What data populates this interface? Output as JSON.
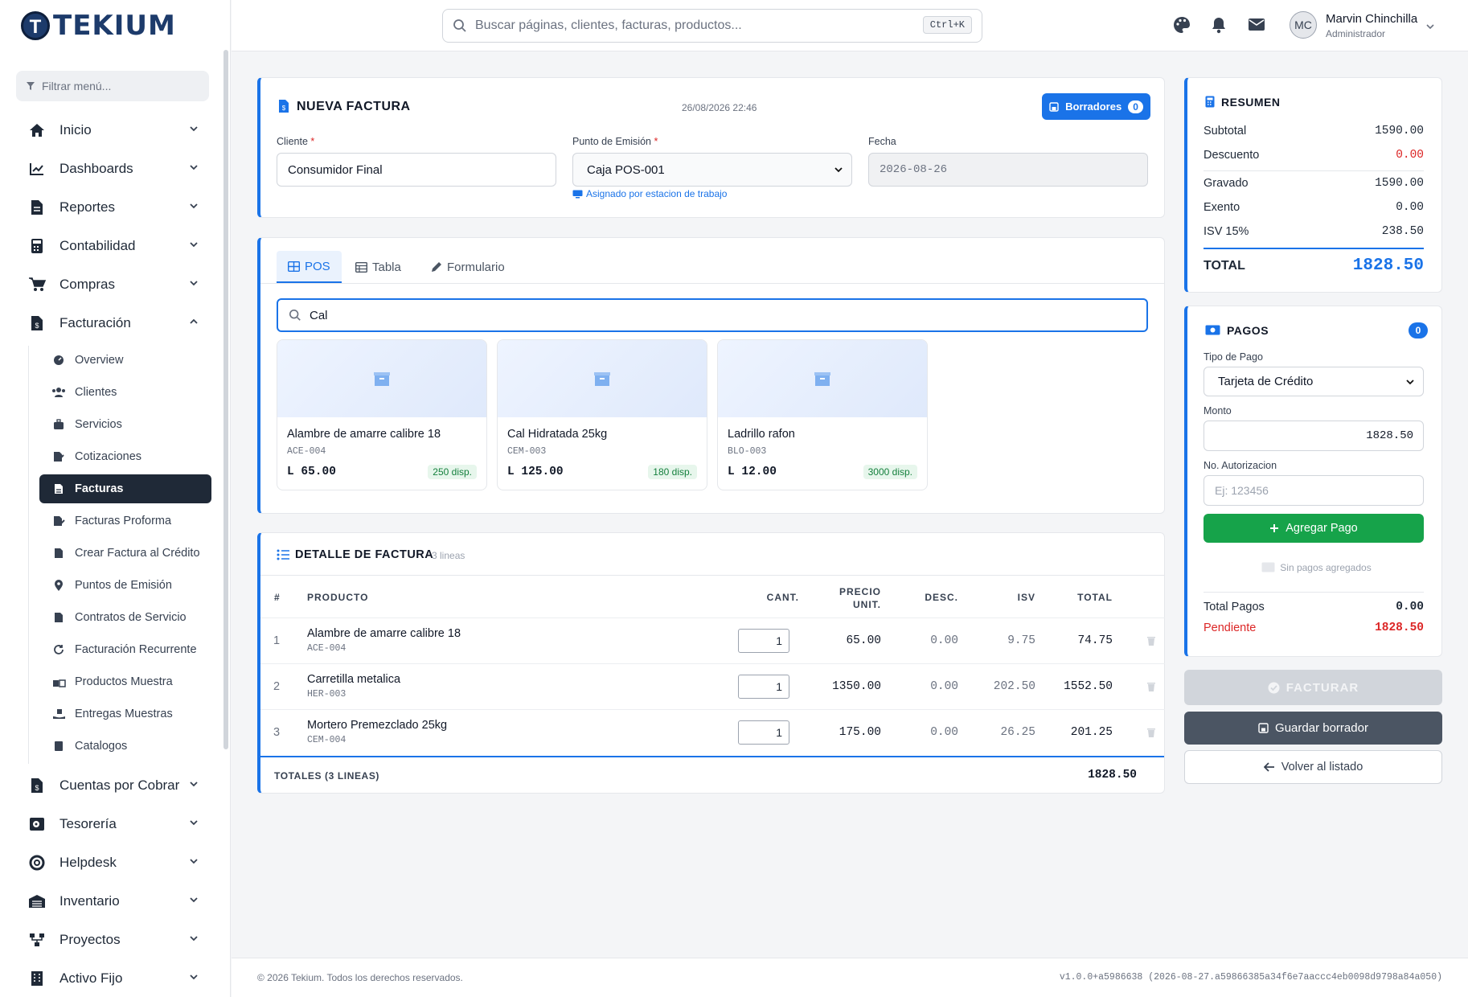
{
  "app": {
    "brand": "TEKIUM"
  },
  "sidebar": {
    "filter_placeholder": "Filtrar menú...",
    "items": [
      {
        "label": "Inicio"
      },
      {
        "label": "Dashboards"
      },
      {
        "label": "Reportes"
      },
      {
        "label": "Contabilidad"
      },
      {
        "label": "Compras"
      },
      {
        "label": "Facturación"
      },
      {
        "label": "Cuentas por Cobrar"
      },
      {
        "label": "Tesorería"
      },
      {
        "label": "Helpdesk"
      },
      {
        "label": "Inventario"
      },
      {
        "label": "Proyectos"
      },
      {
        "label": "Activo Fijo"
      }
    ],
    "subitems": [
      {
        "label": "Overview"
      },
      {
        "label": "Clientes"
      },
      {
        "label": "Servicios"
      },
      {
        "label": "Cotizaciones"
      },
      {
        "label": "Facturas"
      },
      {
        "label": "Facturas Proforma"
      },
      {
        "label": "Crear Factura al Crédito"
      },
      {
        "label": "Puntos de Emisión"
      },
      {
        "label": "Contratos de Servicio"
      },
      {
        "label": "Facturación Recurrente"
      },
      {
        "label": "Productos Muestra"
      },
      {
        "label": "Entregas Muestras"
      },
      {
        "label": "Catalogos"
      }
    ]
  },
  "topbar": {
    "search_placeholder": "Buscar páginas, clientes, facturas, productos...",
    "search_shortcut": "Ctrl+K",
    "user_initials": "MC",
    "user_name": "Marvin Chinchilla",
    "user_role": "Administrador"
  },
  "invoice": {
    "title": "NUEVA FACTURA",
    "datetime": "26/08/2026 22:46",
    "drafts_label": "Borradores",
    "drafts_count": "0",
    "client_label": "Cliente",
    "client_value": "Consumidor Final",
    "emission_label": "Punto de Emisión",
    "emission_value": "Caja POS-001",
    "emission_hint": "Asignado por estacion de trabajo",
    "date_label": "Fecha",
    "date_value": "2026-08-26"
  },
  "pos": {
    "tabs": [
      {
        "label": "POS"
      },
      {
        "label": "Tabla"
      },
      {
        "label": "Formulario"
      }
    ],
    "search_value": "Cal",
    "products": [
      {
        "name": "Alambre de amarre calibre 18",
        "code": "ACE-004",
        "price": "L 65.00",
        "stock": "250 disp."
      },
      {
        "name": "Cal Hidratada 25kg",
        "code": "CEM-003",
        "price": "L 125.00",
        "stock": "180 disp."
      },
      {
        "name": "Ladrillo rafon",
        "code": "BLO-003",
        "price": "L 12.00",
        "stock": "3000 disp."
      }
    ]
  },
  "detail": {
    "title": "DETALLE DE FACTURA",
    "line_count": "3 lineas",
    "columns": {
      "num": "#",
      "product": "PRODUCTO",
      "qty": "CANT.",
      "price": "PRECIO UNIT.",
      "disc": "DESC.",
      "isv": "ISV",
      "total": "TOTAL"
    },
    "rows": [
      {
        "num": "1",
        "name": "Alambre de amarre calibre 18",
        "code": "ACE-004",
        "qty": "1",
        "price": "65.00",
        "disc": "0.00",
        "isv": "9.75",
        "total": "74.75"
      },
      {
        "num": "2",
        "name": "Carretilla metalica",
        "code": "HER-003",
        "qty": "1",
        "price": "1350.00",
        "disc": "0.00",
        "isv": "202.50",
        "total": "1552.50"
      },
      {
        "num": "3",
        "name": "Mortero Premezclado 25kg",
        "code": "CEM-004",
        "qty": "1",
        "price": "175.00",
        "disc": "0.00",
        "isv": "26.25",
        "total": "201.25"
      }
    ],
    "totals_label": "TOTALES (3 LINEAS)",
    "totals_value": "1828.50"
  },
  "summary": {
    "title": "RESUMEN",
    "subtotal_label": "Subtotal",
    "subtotal": "1590.00",
    "discount_label": "Descuento",
    "discount": "0.00",
    "taxed_label": "Gravado",
    "taxed": "1590.00",
    "exempt_label": "Exento",
    "exempt": "0.00",
    "isv_label": "ISV 15%",
    "isv": "238.50",
    "total_label": "TOTAL",
    "total": "1828.50"
  },
  "payments": {
    "title": "PAGOS",
    "count": "0",
    "type_label": "Tipo de Pago",
    "type_value": "Tarjeta de Crédito",
    "amount_label": "Monto",
    "amount_value": "1828.50",
    "auth_label": "No. Autorizacion",
    "auth_placeholder": "Ej: 123456",
    "add_label": "Agregar Pago",
    "empty_text": "Sin pagos agregados",
    "total_label": "Total Pagos",
    "total": "0.00",
    "pending_label": "Pendiente",
    "pending": "1828.50"
  },
  "actions": {
    "invoice": "FACTURAR",
    "save_draft": "Guardar borrador",
    "back": "Volver al listado"
  },
  "footer": {
    "copyright": "© 2026 Tekium. Todos los derechos reservados.",
    "version": "v1.0.0+a5986638 (2026-08-27.a59866385a34f6e7aaccc4eb0098d9798a84a050)"
  },
  "colors": {
    "primary": "#1a73e8",
    "success": "#16a34a",
    "danger": "#dc2626",
    "dark": "#1f2937"
  }
}
